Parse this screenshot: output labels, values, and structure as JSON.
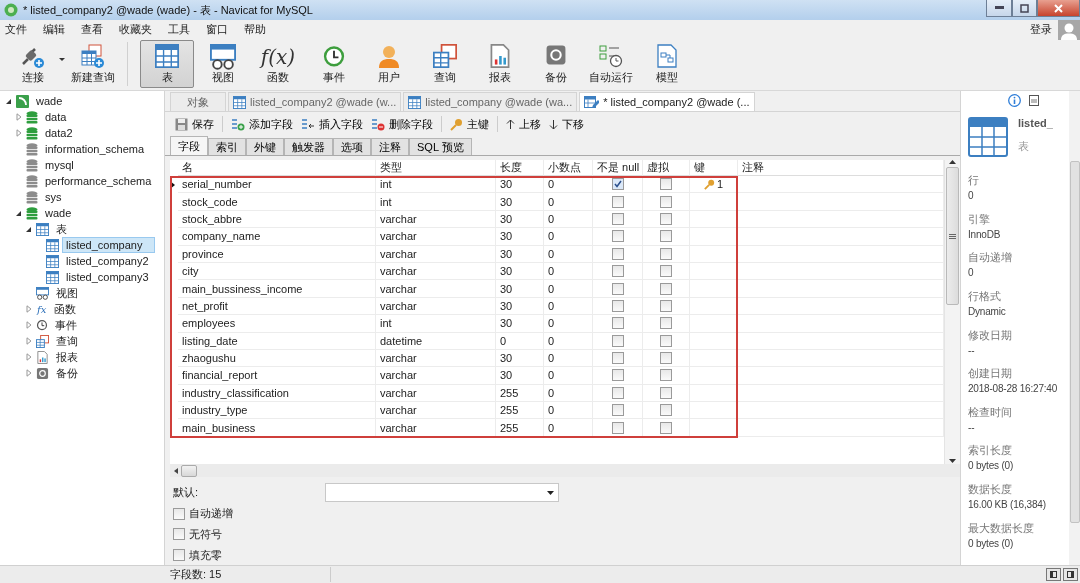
{
  "window": {
    "title": "* listed_company2 @wade (wade) - 表 - Navicat for MySQL"
  },
  "menu": [
    "文件",
    "编辑",
    "查看",
    "收藏夹",
    "工具",
    "窗口",
    "帮助"
  ],
  "login": "登录",
  "toolbar": [
    [
      {
        "label": "连接",
        "selected": false,
        "dropdown": true
      },
      {
        "label": "新建查询",
        "selected": false,
        "dropdown": false
      }
    ],
    [
      {
        "label": "表",
        "selected": true,
        "dropdown": false
      },
      {
        "label": "视图",
        "selected": false,
        "dropdown": false
      },
      {
        "label": "函数",
        "selected": false,
        "dropdown": false,
        "glyph": "f(x)"
      },
      {
        "label": "事件",
        "selected": false,
        "dropdown": false
      },
      {
        "label": "用户",
        "selected": false,
        "dropdown": false
      },
      {
        "label": "查询",
        "selected": false,
        "dropdown": false
      },
      {
        "label": "报表",
        "selected": false,
        "dropdown": false
      },
      {
        "label": "备份",
        "selected": false,
        "dropdown": false
      },
      {
        "label": "自动运行",
        "selected": false,
        "dropdown": false
      },
      {
        "label": "模型",
        "selected": false,
        "dropdown": false
      }
    ]
  ],
  "tree": [
    {
      "label": "wade",
      "kind": "connection",
      "expanded": true,
      "selected": false,
      "children": [
        {
          "label": "data",
          "kind": "database",
          "open": true,
          "expanded": false,
          "selected": false
        },
        {
          "label": "data2",
          "kind": "database",
          "open": true,
          "expanded": false,
          "selected": false
        },
        {
          "label": "information_schema",
          "kind": "database",
          "open": false,
          "selected": false
        },
        {
          "label": "mysql",
          "kind": "database",
          "open": false,
          "selected": false
        },
        {
          "label": "performance_schema",
          "kind": "database",
          "open": false,
          "selected": false
        },
        {
          "label": "sys",
          "kind": "database",
          "open": false,
          "selected": false
        },
        {
          "label": "wade",
          "kind": "database",
          "open": true,
          "expanded": true,
          "selected": false,
          "children": [
            {
              "label": "表",
              "kind": "tables",
              "expanded": true,
              "selected": false,
              "children": [
                {
                  "label": "listed_company",
                  "kind": "table",
                  "selected": true
                },
                {
                  "label": "listed_company2",
                  "kind": "table",
                  "selected": false
                },
                {
                  "label": "listed_company3",
                  "kind": "table",
                  "selected": false
                }
              ]
            },
            {
              "label": "视图",
              "kind": "views",
              "selected": false
            },
            {
              "label": "函数",
              "kind": "functions",
              "glyph": "fx",
              "expanded": false,
              "selected": false
            },
            {
              "label": "事件",
              "kind": "events",
              "expanded": false,
              "selected": false
            },
            {
              "label": "查询",
              "kind": "queries",
              "expanded": false,
              "selected": false
            },
            {
              "label": "报表",
              "kind": "reports",
              "expanded": false,
              "selected": false
            },
            {
              "label": "备份",
              "kind": "backups",
              "expanded": false,
              "selected": false
            }
          ]
        }
      ]
    }
  ],
  "tabs": [
    {
      "label": "对象",
      "kind": "objects",
      "selected": false
    },
    {
      "label": "listed_company2 @wade (w...",
      "kind": "table",
      "selected": false
    },
    {
      "label": "listed_company @wade (wa...",
      "kind": "table",
      "selected": false
    },
    {
      "label": "* listed_company2 @wade (...",
      "kind": "design",
      "selected": true
    }
  ],
  "actions": [
    [
      "保存"
    ],
    [
      "添加字段",
      "插入字段",
      "删除字段"
    ],
    [
      "主键"
    ],
    [
      "上移",
      "下移"
    ]
  ],
  "subtabs": [
    {
      "label": "字段",
      "selected": true
    },
    {
      "label": "索引",
      "selected": false
    },
    {
      "label": "外键",
      "selected": false
    },
    {
      "label": "触发器",
      "selected": false
    },
    {
      "label": "选项",
      "selected": false
    },
    {
      "label": "注释",
      "selected": false
    },
    {
      "label": "SQL 预览",
      "selected": false
    }
  ],
  "columns": [
    "名",
    "类型",
    "长度",
    "小数点",
    "不是 null",
    "虚拟",
    "键",
    "注释"
  ],
  "rows": [
    {
      "name": "serial_number",
      "type": "int",
      "length": "30",
      "decimals": "0",
      "not_null": true,
      "virtual": false,
      "key": "1",
      "selected": true
    },
    {
      "name": "stock_code",
      "type": "int",
      "length": "30",
      "decimals": "0",
      "not_null": false,
      "virtual": false,
      "selected": false
    },
    {
      "name": "stock_abbre",
      "type": "varchar",
      "length": "30",
      "decimals": "0",
      "not_null": false,
      "virtual": false,
      "selected": false
    },
    {
      "name": "company_name",
      "type": "varchar",
      "length": "30",
      "decimals": "0",
      "not_null": false,
      "virtual": false,
      "selected": false
    },
    {
      "name": "province",
      "type": "varchar",
      "length": "30",
      "decimals": "0",
      "not_null": false,
      "virtual": false,
      "selected": false
    },
    {
      "name": "city",
      "type": "varchar",
      "length": "30",
      "decimals": "0",
      "not_null": false,
      "virtual": false,
      "selected": false
    },
    {
      "name": "main_bussiness_income",
      "type": "varchar",
      "length": "30",
      "decimals": "0",
      "not_null": false,
      "virtual": false,
      "selected": false
    },
    {
      "name": "net_profit",
      "type": "varchar",
      "length": "30",
      "decimals": "0",
      "not_null": false,
      "virtual": false,
      "selected": false
    },
    {
      "name": "employees",
      "type": "int",
      "length": "30",
      "decimals": "0",
      "not_null": false,
      "virtual": false,
      "selected": false
    },
    {
      "name": "listing_date",
      "type": "datetime",
      "length": "0",
      "decimals": "0",
      "not_null": false,
      "virtual": false,
      "selected": false
    },
    {
      "name": "zhaogushu",
      "type": "varchar",
      "length": "30",
      "decimals": "0",
      "not_null": false,
      "virtual": false,
      "selected": false
    },
    {
      "name": "financial_report",
      "type": "varchar",
      "length": "30",
      "decimals": "0",
      "not_null": false,
      "virtual": false,
      "selected": false
    },
    {
      "name": "industry_classification",
      "type": "varchar",
      "length": "255",
      "decimals": "0",
      "not_null": false,
      "virtual": false,
      "selected": false
    },
    {
      "name": "industry_type",
      "type": "varchar",
      "length": "255",
      "decimals": "0",
      "not_null": false,
      "virtual": false,
      "selected": false
    },
    {
      "name": "main_business",
      "type": "varchar",
      "length": "255",
      "decimals": "0",
      "not_null": false,
      "virtual": false,
      "selected": false
    }
  ],
  "field_options": {
    "default_label": "默认:",
    "checkboxes": [
      {
        "label": "自动递增",
        "checked": false
      },
      {
        "label": "无符号",
        "checked": false
      },
      {
        "label": "填充零",
        "checked": false
      }
    ]
  },
  "info": {
    "title": "listed_",
    "subtitle": "表",
    "properties": [
      {
        "label": "行",
        "value": "0"
      },
      {
        "label": "引擎",
        "value": "InnoDB"
      },
      {
        "label": "自动递增",
        "value": "0"
      },
      {
        "label": "行格式",
        "value": "Dynamic"
      },
      {
        "label": "修改日期",
        "value": "--"
      },
      {
        "label": "创建日期",
        "value": "2018-08-28 16:27:40"
      },
      {
        "label": "检查时间",
        "value": "--"
      },
      {
        "label": "索引长度",
        "value": "0 bytes (0)"
      },
      {
        "label": "数据长度",
        "value": "16.00 KB (16,384)"
      },
      {
        "label": "最大数据长度",
        "value": "0 bytes (0)"
      }
    ]
  },
  "status": "字段数: 15"
}
